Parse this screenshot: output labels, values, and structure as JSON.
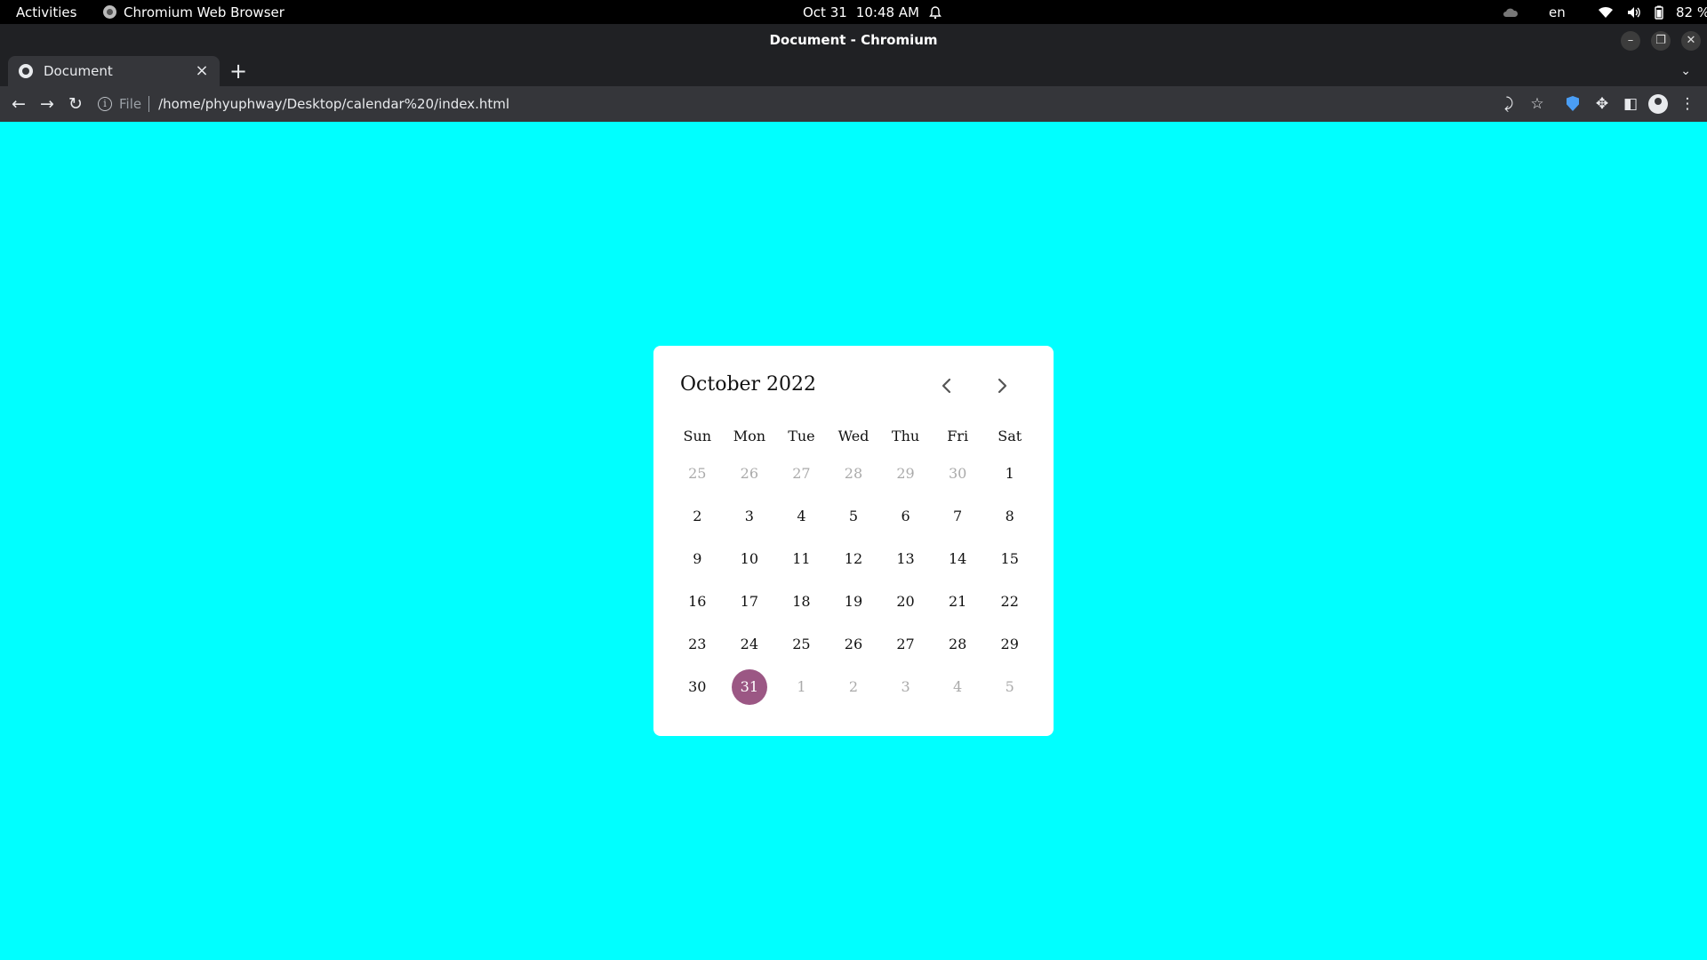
{
  "system_bar": {
    "activities": "Activities",
    "app_name": "Chromium Web Browser",
    "date": "Oct 31",
    "time": "10:48 AM",
    "language": "en",
    "battery": "82 %"
  },
  "window": {
    "title": "Document - Chromium"
  },
  "tabs": [
    {
      "title": "Document"
    }
  ],
  "toolbar": {
    "scheme_label": "File",
    "url": "/home/phyuphway/Desktop/calendar%20/index.html"
  },
  "calendar": {
    "month_year": "October 2022",
    "weekdays": [
      "Sun",
      "Mon",
      "Tue",
      "Wed",
      "Thu",
      "Fri",
      "Sat"
    ],
    "days": [
      {
        "label": "25",
        "state": "inactive"
      },
      {
        "label": "26",
        "state": "inactive"
      },
      {
        "label": "27",
        "state": "inactive"
      },
      {
        "label": "28",
        "state": "inactive"
      },
      {
        "label": "29",
        "state": "inactive"
      },
      {
        "label": "30",
        "state": "inactive"
      },
      {
        "label": "1",
        "state": "normal"
      },
      {
        "label": "2",
        "state": "normal"
      },
      {
        "label": "3",
        "state": "normal"
      },
      {
        "label": "4",
        "state": "normal"
      },
      {
        "label": "5",
        "state": "normal"
      },
      {
        "label": "6",
        "state": "normal"
      },
      {
        "label": "7",
        "state": "normal"
      },
      {
        "label": "8",
        "state": "normal"
      },
      {
        "label": "9",
        "state": "normal"
      },
      {
        "label": "10",
        "state": "normal"
      },
      {
        "label": "11",
        "state": "normal"
      },
      {
        "label": "12",
        "state": "normal"
      },
      {
        "label": "13",
        "state": "normal"
      },
      {
        "label": "14",
        "state": "normal"
      },
      {
        "label": "15",
        "state": "normal"
      },
      {
        "label": "16",
        "state": "normal"
      },
      {
        "label": "17",
        "state": "normal"
      },
      {
        "label": "18",
        "state": "normal"
      },
      {
        "label": "19",
        "state": "normal"
      },
      {
        "label": "20",
        "state": "normal"
      },
      {
        "label": "21",
        "state": "normal"
      },
      {
        "label": "22",
        "state": "normal"
      },
      {
        "label": "23",
        "state": "normal"
      },
      {
        "label": "24",
        "state": "normal"
      },
      {
        "label": "25",
        "state": "normal"
      },
      {
        "label": "26",
        "state": "normal"
      },
      {
        "label": "27",
        "state": "normal"
      },
      {
        "label": "28",
        "state": "normal"
      },
      {
        "label": "29",
        "state": "normal"
      },
      {
        "label": "30",
        "state": "normal"
      },
      {
        "label": "31",
        "state": "active"
      },
      {
        "label": "1",
        "state": "inactive"
      },
      {
        "label": "2",
        "state": "inactive"
      },
      {
        "label": "3",
        "state": "inactive"
      },
      {
        "label": "4",
        "state": "inactive"
      },
      {
        "label": "5",
        "state": "inactive"
      }
    ]
  },
  "colors": {
    "page_background": "#00ffff",
    "selected_day": "#9b5784",
    "inactive_day_text": "#aaaaaa"
  },
  "icons": {
    "prev": "chevron-left-icon",
    "next": "chevron-right-icon"
  }
}
